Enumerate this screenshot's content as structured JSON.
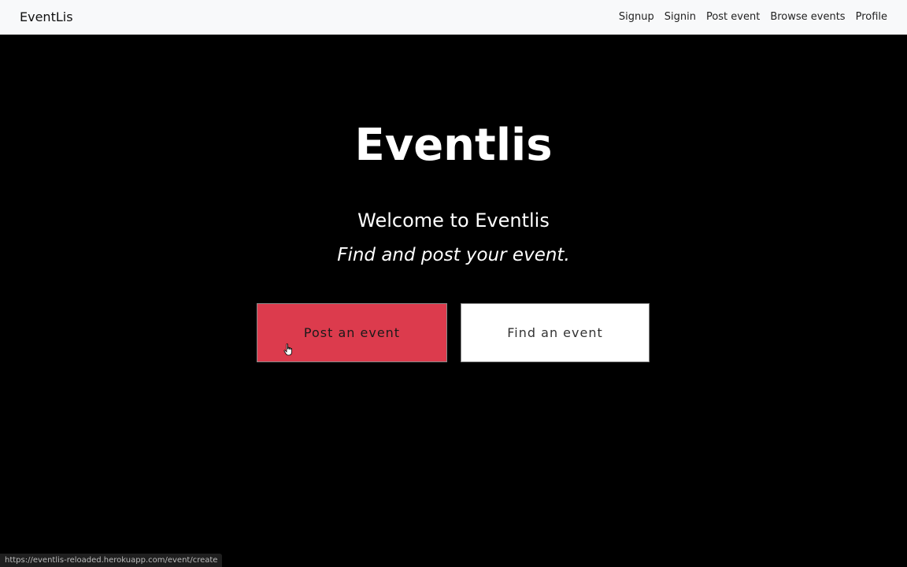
{
  "navbar": {
    "brand": "EventLis",
    "links": [
      {
        "label": "Signup"
      },
      {
        "label": "Signin"
      },
      {
        "label": "Post event"
      },
      {
        "label": "Browse events"
      },
      {
        "label": "Profile"
      }
    ]
  },
  "hero": {
    "title": "Eventlis",
    "welcome": "Welcome to Eventlis",
    "tagline": "Find and post your event.",
    "post_button": "Post an event",
    "find_button": "Find an event"
  },
  "status_bar": {
    "url": "https://eventlis-reloaded.herokuapp.com/event/create"
  },
  "colors": {
    "navbar_bg": "#f8f9fa",
    "hero_bg": "#000000",
    "post_button_bg": "#dc3b4d",
    "find_button_bg": "#ffffff"
  },
  "icons": {
    "cursor": "hand-pointer-icon"
  }
}
